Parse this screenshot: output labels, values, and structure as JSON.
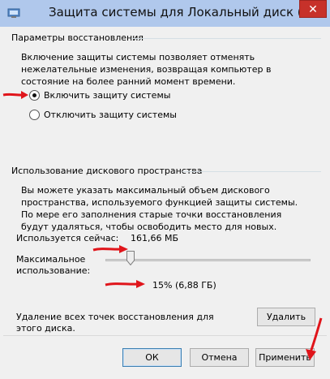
{
  "window": {
    "title": "Защита системы для Локальный диск (C:)",
    "close_glyph": "✕"
  },
  "restore": {
    "section_title": "Параметры восстановления",
    "description": "Включение защиты системы позволяет отменять нежелательные изменения, возвращая компьютер в состояние на более ранний момент времени.",
    "options": [
      {
        "label": "Включить защиту системы",
        "checked": true
      },
      {
        "label": "Отключить защиту системы",
        "checked": false
      }
    ]
  },
  "disk": {
    "section_title": "Использование дискового пространства",
    "description": "Вы можете указать максимальный объем дискового пространства, используемого функцией защиты системы. По мере его заполнения старые точки восстановления будут удаляться, чтобы освободить место для новых.",
    "current_label": "Используется сейчас:",
    "current_value": "161,66 МБ",
    "max_label": "Максимальное использование:",
    "slider_percent": 15,
    "slider_readout": "15% (6,88 ГБ)",
    "delete_text": "Удаление всех точек восстановления для этого диска.",
    "delete_button": "Удалить"
  },
  "footer": {
    "ok": "ОК",
    "cancel": "Отмена",
    "apply": "Применить"
  },
  "colors": {
    "title_bar": "#b0c8ec",
    "close_button": "#c7312a",
    "annotation_arrow": "#e0151b"
  }
}
